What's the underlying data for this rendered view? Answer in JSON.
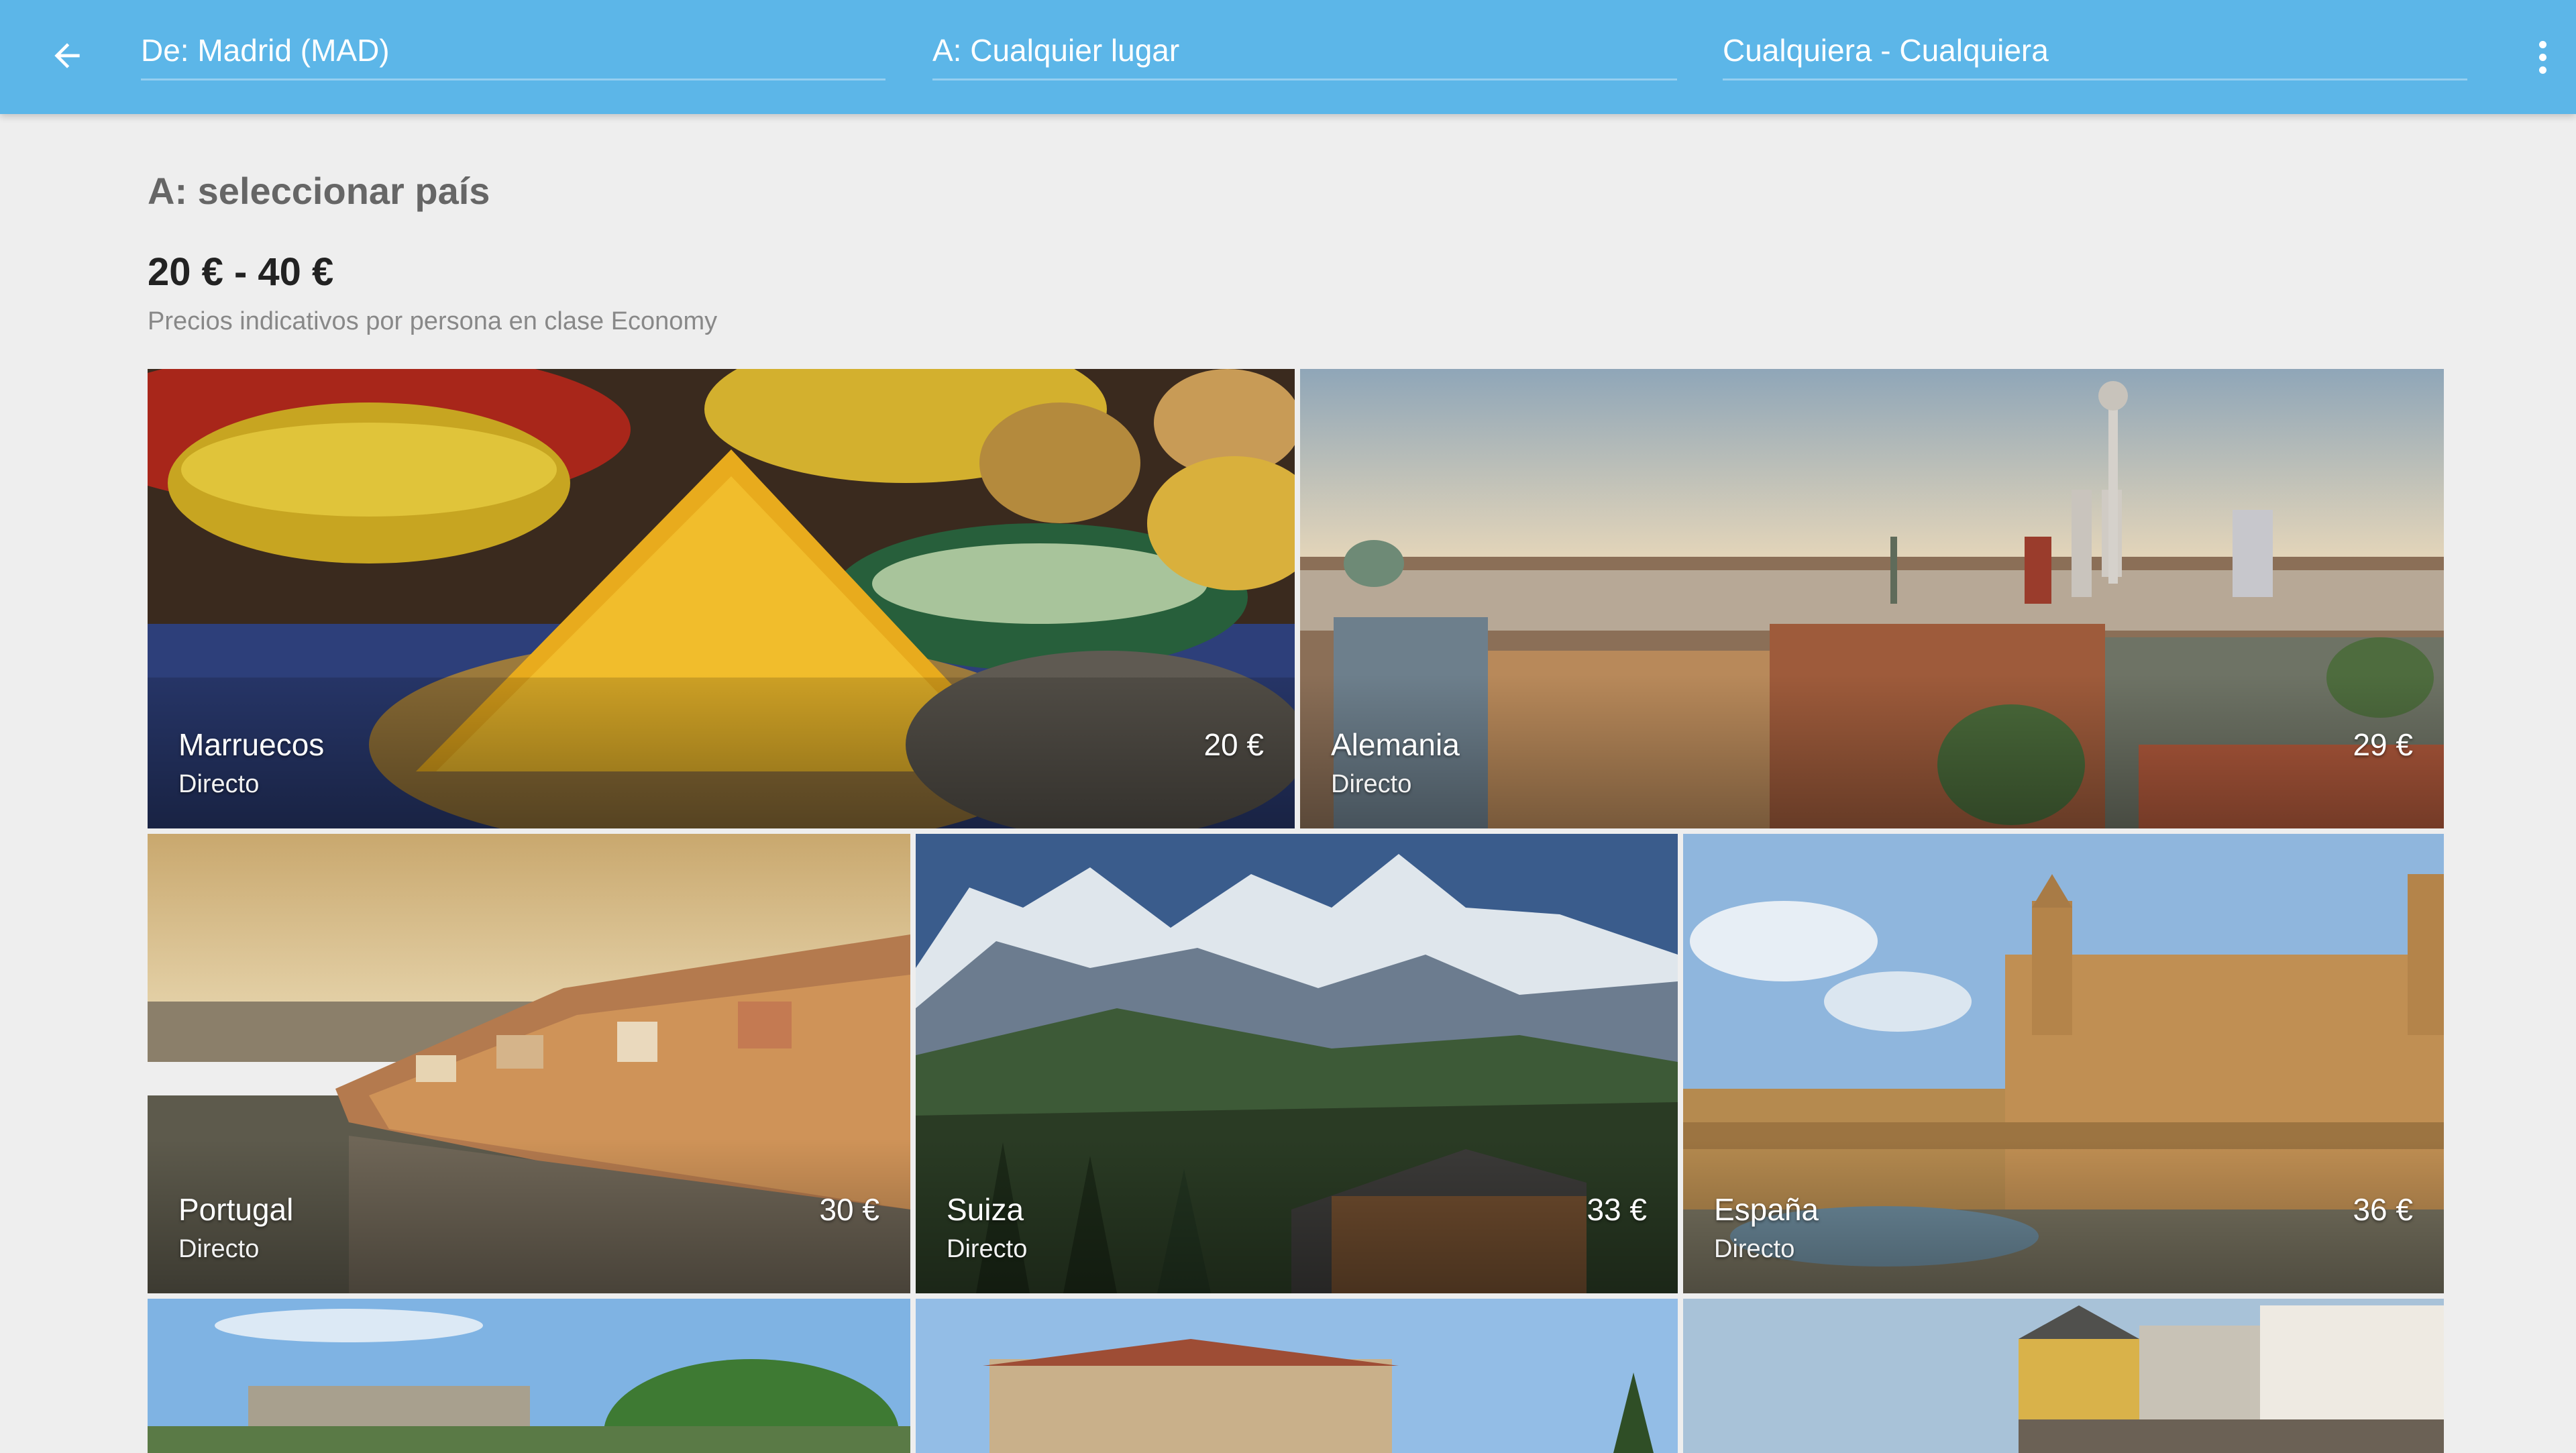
{
  "appbar": {
    "from": "De: Madrid (MAD)",
    "to": "A: Cualquier lugar",
    "dates": "Cualquiera - Cualquiera",
    "back_icon": "arrow-back-icon",
    "menu_icon": "more-vert-icon",
    "color": "#5cb6e8"
  },
  "header": {
    "title": "A: seleccionar país",
    "price_range": "20 € - 40 €",
    "price_note": "Precios indicativos por persona en clase Economy"
  },
  "destinations": [
    {
      "name": "Marruecos",
      "type": "Directo",
      "price": "20 €"
    },
    {
      "name": "Alemania",
      "type": "Directo",
      "price": "29 €"
    },
    {
      "name": "Portugal",
      "type": "Directo",
      "price": "30 €"
    },
    {
      "name": "Suiza",
      "type": "Directo",
      "price": "33 €"
    },
    {
      "name": "España",
      "type": "Directo",
      "price": "36 €"
    }
  ]
}
